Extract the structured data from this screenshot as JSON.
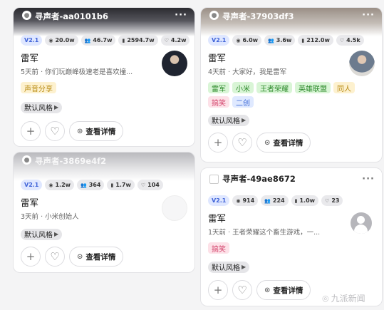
{
  "cards": [
    {
      "title": "寻声者-aa0101b6",
      "version": "V2.1",
      "stats": [
        "20.0w",
        "46.7w",
        "2594.7w",
        "4.2w"
      ],
      "name": "雷军",
      "desc": "5天前 · 你们玩巅峰极速老是喜欢撞...",
      "tags": [
        "声音分享"
      ],
      "style": "默认风格",
      "detail": "查看详情"
    },
    {
      "title": "寻声者-37903df3",
      "version": "V2.1",
      "stats": [
        "6.0w",
        "3.6w",
        "212.0w",
        "4.5k"
      ],
      "name": "雷军",
      "desc": "4天前 · 大家好，我是雷军",
      "tags": [
        "雷军",
        "小米",
        "王者荣耀",
        "英雄联盟",
        "同人",
        "搞笑",
        "二创"
      ],
      "style": "默认风格",
      "detail": "查看详情"
    },
    {
      "title": "寻声者-3869e4f2",
      "version": "V2.1",
      "stats": [
        "1.2w",
        "364",
        "1.7w",
        "104"
      ],
      "name": "雷军",
      "desc": "3天前 · 小米创始人",
      "style": "默认风格",
      "detail": "查看详情"
    },
    {
      "title": "寻声者-49ae8672",
      "version": "V2.1",
      "stats": [
        "914",
        "224",
        "1.0w",
        "23"
      ],
      "name": "雷军",
      "desc": "1天前 · 王者荣耀这个畜生游戏，一...",
      "tags": [
        "搞笑"
      ],
      "style": "默认风格",
      "detail": "查看详情"
    }
  ],
  "icons": {
    "more": "more-icon",
    "plays": "play-count-icon",
    "users": "users-icon",
    "files": "file-icon",
    "likes": "heart-icon",
    "add": "plus-icon",
    "like_btn": "heart-icon",
    "detail": "chat-icon"
  },
  "watermark": "九派新闻",
  "colors": {
    "version_bg": "#dfe7ff",
    "version_text": "#3f63d8",
    "page_bg": "#f4f4f5"
  }
}
